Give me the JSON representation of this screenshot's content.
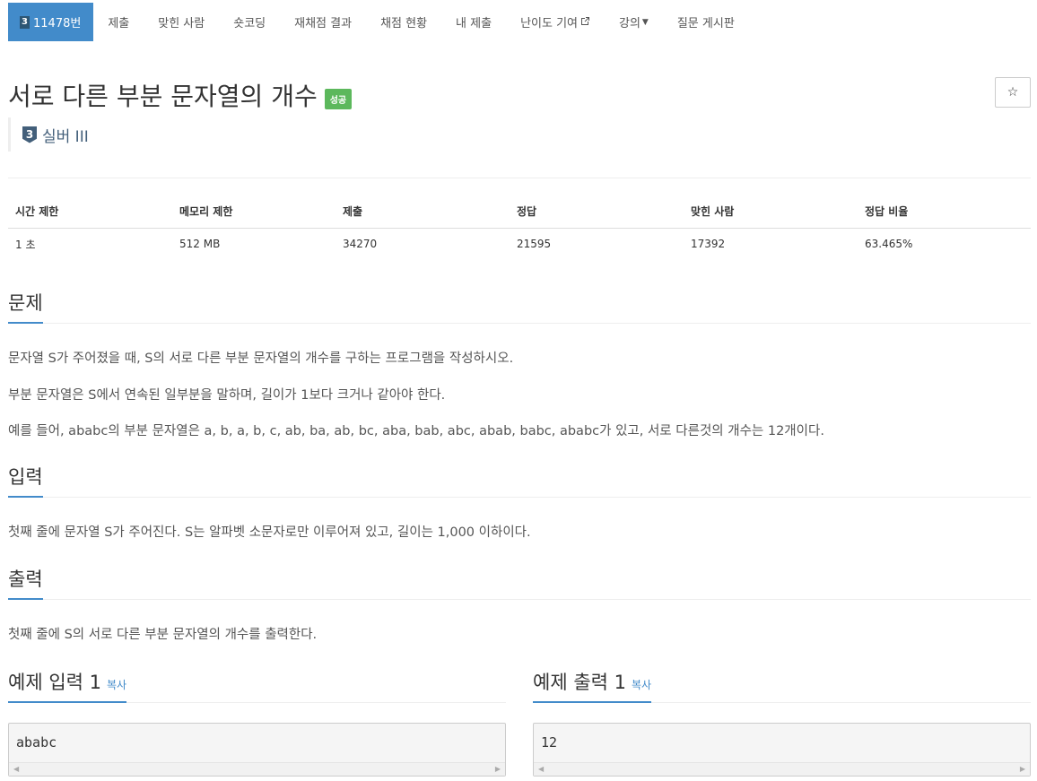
{
  "nav": {
    "problem_tier_badge": "3",
    "problem_number": "11478번",
    "items": [
      "제출",
      "맞힌 사람",
      "숏코딩",
      "재채점 결과",
      "채점 현황",
      "내 제출",
      "난이도 기여",
      "강의",
      "질문 게시판"
    ]
  },
  "problem": {
    "title": "서로 다른 부분 문자열의 개수",
    "status_label": "성공",
    "star_icon": "☆",
    "tier_number": "3",
    "tier_text": "실버 III"
  },
  "info_table": {
    "headers": [
      "시간 제한",
      "메모리 제한",
      "제출",
      "정답",
      "맞힌 사람",
      "정답 비율"
    ],
    "values": [
      "1 초",
      "512 MB",
      "34270",
      "21595",
      "17392",
      "63.465%"
    ]
  },
  "sections": {
    "description_title": "문제",
    "description": [
      "문자열 S가 주어졌을 때, S의 서로 다른 부분 문자열의 개수를 구하는 프로그램을 작성하시오.",
      "부분 문자열은 S에서 연속된 일부분을 말하며, 길이가 1보다 크거나 같아야 한다.",
      "예를 들어, ababc의 부분 문자열은 a, b, a, b, c, ab, ba, ab, bc, aba, bab, abc, abab, babc, ababc가 있고, 서로 다른것의 개수는 12개이다."
    ],
    "input_title": "입력",
    "input": "첫째 줄에 문자열 S가 주어진다. S는 알파벳 소문자로만 이루어져 있고, 길이는 1,000 이하이다.",
    "output_title": "출력",
    "output": "첫째 줄에 S의 서로 다른 부분 문자열의 개수를 출력한다."
  },
  "samples": {
    "input_title": "예제 입력 1",
    "output_title": "예제 출력 1",
    "copy_label": "복사",
    "input_value": "ababc",
    "output_value": "12"
  },
  "colors": {
    "accent": "#428bca",
    "success": "#5cb85c",
    "tier_silver": "#435f7a"
  }
}
